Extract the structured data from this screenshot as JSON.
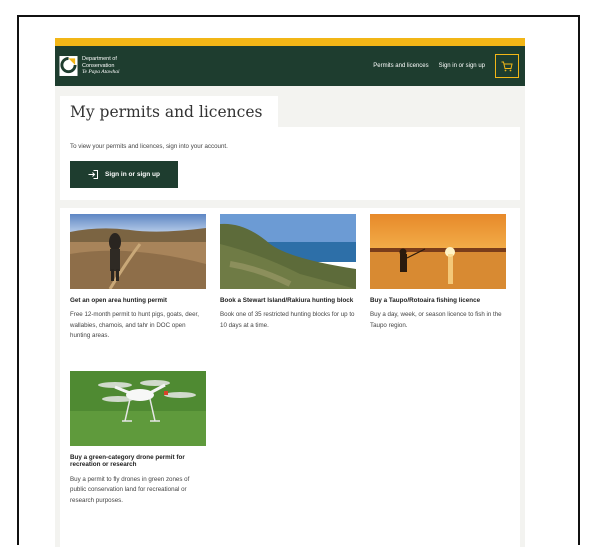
{
  "header": {
    "logo_lines": [
      "Department of",
      "Conservation",
      "Te Papa Atawhai"
    ],
    "nav": [
      "Permits and licences",
      "Sign in or sign up"
    ],
    "cart_icon": "cart-icon",
    "colors": {
      "brand": "#1e3d2f",
      "accent": "#f2b617"
    }
  },
  "page": {
    "title": "My permits and licences",
    "signin_text": "To view your permits and licences, sign into your account.",
    "signin_button": "Sign in or sign up"
  },
  "cards": [
    {
      "title": "Get an open area hunting permit",
      "desc": "Free 12-month permit to hunt pigs, goats, deer, wallabies, chamois, and tahr in DOC open hunting areas."
    },
    {
      "title": "Book a Stewart Island/Rakiura hunting block",
      "desc": "Book one of 35 restricted hunting blocks for up to 10 days at a time."
    },
    {
      "title": "Buy a Taupo/Rotoaira fishing licence",
      "desc": "Buy a day, week, or season licence to fish in the Taupo region."
    },
    {
      "title": "Buy a green-category drone permit for recreation or research",
      "desc": "Buy a permit to fly drones in green zones of public conservation land for recreational or research purposes."
    }
  ]
}
